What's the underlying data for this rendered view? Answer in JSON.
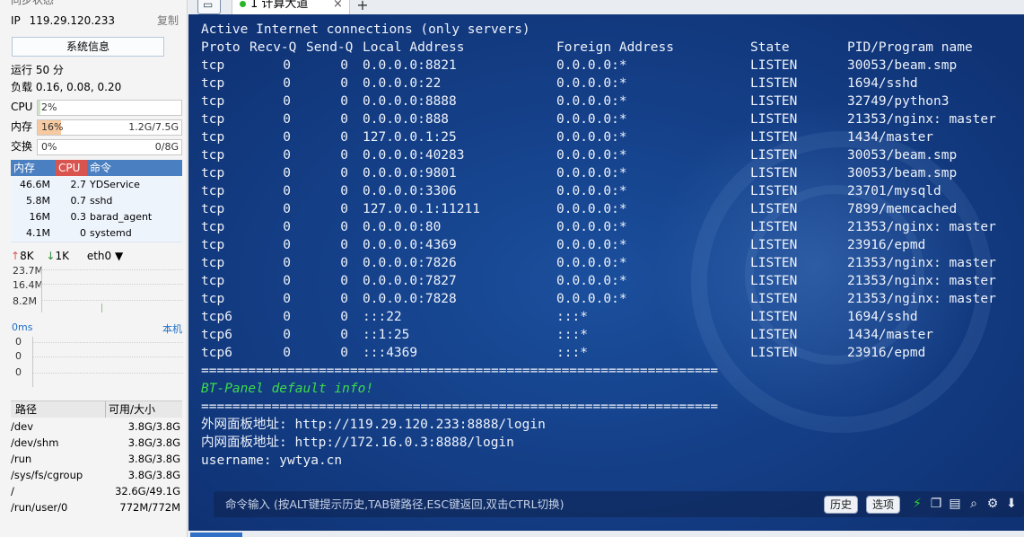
{
  "sidebar": {
    "status_title": "同步状态",
    "ip_label": "IP",
    "ip_value": "119.29.120.233",
    "copy_label": "复制",
    "sysinfo_button": "系统信息",
    "uptime": "运行 50 分",
    "load": "负载 0.16, 0.08, 0.20",
    "cpu": {
      "label": "CPU",
      "percent_text": "2%",
      "percent": 2
    },
    "mem": {
      "label": "内存",
      "percent_text": "16%",
      "percent": 16,
      "usage": "1.2G/7.5G"
    },
    "swap": {
      "label": "交换",
      "percent_text": "0%",
      "percent": 0,
      "usage": "0/8G"
    },
    "process_table": {
      "headers": [
        "内存",
        "CPU",
        "命令"
      ],
      "rows": [
        {
          "mem": "46.6M",
          "cpu": "2.7",
          "cmd": "YDService"
        },
        {
          "mem": "5.8M",
          "cpu": "0.7",
          "cmd": "sshd"
        },
        {
          "mem": "16M",
          "cpu": "0.3",
          "cmd": "barad_agent"
        },
        {
          "mem": "4.1M",
          "cpu": "0",
          "cmd": "systemd"
        }
      ]
    },
    "network": {
      "up": "8K",
      "down": "1K",
      "iface": "eth0",
      "y_labels": [
        "23.7M",
        "16.4M",
        "8.2M"
      ]
    },
    "latency": {
      "value": "0ms",
      "host": "本机",
      "y_labels": [
        "0",
        "0",
        "0"
      ]
    },
    "disk_table": {
      "headers": [
        "路径",
        "可用/大小"
      ],
      "rows": [
        {
          "path": "/dev",
          "size": "3.8G/3.8G"
        },
        {
          "path": "/dev/shm",
          "size": "3.8G/3.8G"
        },
        {
          "path": "/run",
          "size": "3.8G/3.8G"
        },
        {
          "path": "/sys/fs/cgroup",
          "size": "3.8G/3.8G"
        },
        {
          "path": "/",
          "size": "32.6G/49.1G"
        },
        {
          "path": "/run/user/0",
          "size": "772M/772M"
        }
      ]
    }
  },
  "tabs": {
    "active_label": "1 计算大道",
    "close_glyph": "×",
    "add_glyph": "+"
  },
  "terminal": {
    "header1": "Active Internet connections (only servers)",
    "columns": [
      "Proto",
      "Recv-Q",
      "Send-Q",
      "Local Address",
      "Foreign Address",
      "State",
      "PID/Program name"
    ],
    "rows": [
      {
        "proto": "tcp",
        "recv": "0",
        "send": "0",
        "local": "0.0.0.0:8821",
        "foreign": "0.0.0.0:*",
        "state": "LISTEN",
        "pid": "30053/beam.smp"
      },
      {
        "proto": "tcp",
        "recv": "0",
        "send": "0",
        "local": "0.0.0.0:22",
        "foreign": "0.0.0.0:*",
        "state": "LISTEN",
        "pid": "1694/sshd"
      },
      {
        "proto": "tcp",
        "recv": "0",
        "send": "0",
        "local": "0.0.0.0:8888",
        "foreign": "0.0.0.0:*",
        "state": "LISTEN",
        "pid": "32749/python3"
      },
      {
        "proto": "tcp",
        "recv": "0",
        "send": "0",
        "local": "0.0.0.0:888",
        "foreign": "0.0.0.0:*",
        "state": "LISTEN",
        "pid": "21353/nginx: master"
      },
      {
        "proto": "tcp",
        "recv": "0",
        "send": "0",
        "local": "127.0.0.1:25",
        "foreign": "0.0.0.0:*",
        "state": "LISTEN",
        "pid": "1434/master"
      },
      {
        "proto": "tcp",
        "recv": "0",
        "send": "0",
        "local": "0.0.0.0:40283",
        "foreign": "0.0.0.0:*",
        "state": "LISTEN",
        "pid": "30053/beam.smp"
      },
      {
        "proto": "tcp",
        "recv": "0",
        "send": "0",
        "local": "0.0.0.0:9801",
        "foreign": "0.0.0.0:*",
        "state": "LISTEN",
        "pid": "30053/beam.smp"
      },
      {
        "proto": "tcp",
        "recv": "0",
        "send": "0",
        "local": "0.0.0.0:3306",
        "foreign": "0.0.0.0:*",
        "state": "LISTEN",
        "pid": "23701/mysqld"
      },
      {
        "proto": "tcp",
        "recv": "0",
        "send": "0",
        "local": "127.0.0.1:11211",
        "foreign": "0.0.0.0:*",
        "state": "LISTEN",
        "pid": "7899/memcached"
      },
      {
        "proto": "tcp",
        "recv": "0",
        "send": "0",
        "local": "0.0.0.0:80",
        "foreign": "0.0.0.0:*",
        "state": "LISTEN",
        "pid": "21353/nginx: master"
      },
      {
        "proto": "tcp",
        "recv": "0",
        "send": "0",
        "local": "0.0.0.0:4369",
        "foreign": "0.0.0.0:*",
        "state": "LISTEN",
        "pid": "23916/epmd"
      },
      {
        "proto": "tcp",
        "recv": "0",
        "send": "0",
        "local": "0.0.0.0:7826",
        "foreign": "0.0.0.0:*",
        "state": "LISTEN",
        "pid": "21353/nginx: master"
      },
      {
        "proto": "tcp",
        "recv": "0",
        "send": "0",
        "local": "0.0.0.0:7827",
        "foreign": "0.0.0.0:*",
        "state": "LISTEN",
        "pid": "21353/nginx: master"
      },
      {
        "proto": "tcp",
        "recv": "0",
        "send": "0",
        "local": "0.0.0.0:7828",
        "foreign": "0.0.0.0:*",
        "state": "LISTEN",
        "pid": "21353/nginx: master"
      },
      {
        "proto": "tcp6",
        "recv": "0",
        "send": "0",
        "local": ":::22",
        "foreign": ":::*",
        "state": "LISTEN",
        "pid": "1694/sshd"
      },
      {
        "proto": "tcp6",
        "recv": "0",
        "send": "0",
        "local": "::1:25",
        "foreign": ":::*",
        "state": "LISTEN",
        "pid": "1434/master"
      },
      {
        "proto": "tcp6",
        "recv": "0",
        "send": "0",
        "local": ":::4369",
        "foreign": ":::*",
        "state": "LISTEN",
        "pid": "23916/epmd"
      }
    ],
    "separator": "==================================================================",
    "bt_title": "BT-Panel default info!",
    "outer_url": "外网面板地址: http://119.29.120.233:8888/login",
    "inner_url": "内网面板地址: http://172.16.0.3:8888/login",
    "username": "username: ywtya.cn"
  },
  "cmdbar": {
    "placeholder": "命令输入 (按ALT键提示历史,TAB键路径,ESC键返回,双击CTRL切换)",
    "history_button": "历史",
    "options_button": "选项"
  },
  "colors": {
    "accent": "#4a7fc1",
    "mem_fill": "#f7c9a0",
    "cpu_head": "#d9534f",
    "terminal_bg": "#15418a",
    "bt_green": "#3ddc4a",
    "lightning": "#2bd42b"
  },
  "icons": [
    "copy-icon",
    "paste-icon",
    "search-icon",
    "gear-icon",
    "download-icon",
    "lightning-icon",
    "folder-icon"
  ]
}
